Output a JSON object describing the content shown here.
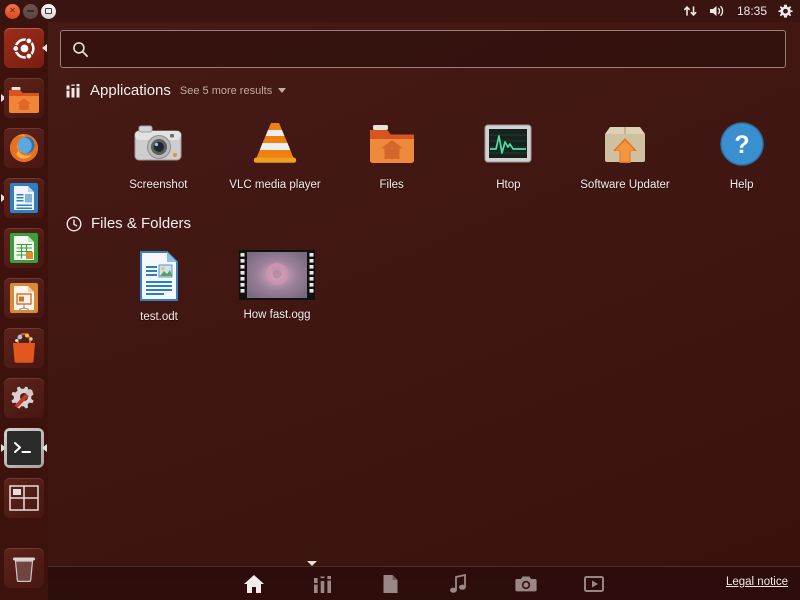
{
  "panel": {
    "window_controls": [
      {
        "name": "close",
        "glyph": "×",
        "color": "#d9481c"
      },
      {
        "name": "minimize",
        "glyph": "–",
        "color": "#5a4340"
      },
      {
        "name": "maximize",
        "glyph": "▭",
        "color": "#d8d2d0"
      }
    ],
    "indicators": [
      {
        "name": "network-icon",
        "label": "network"
      },
      {
        "name": "volume-icon",
        "label": "volume"
      }
    ],
    "clock": "18:35",
    "session_icon": "gear-icon"
  },
  "launcher": {
    "items": [
      {
        "name": "ubuntu-dash-button",
        "label": "Ubuntu Dash home",
        "icon": "ubuntu-logo",
        "active": true,
        "running": false
      },
      {
        "name": "launcher-item-files",
        "label": "Files",
        "icon": "folder-home",
        "running": true
      },
      {
        "name": "launcher-item-firefox",
        "label": "Firefox Web Browser",
        "icon": "firefox",
        "running": false
      },
      {
        "name": "launcher-item-writer",
        "label": "LibreOffice Writer",
        "icon": "writer",
        "running": true
      },
      {
        "name": "launcher-item-calc",
        "label": "LibreOffice Calc",
        "icon": "calc",
        "running": false
      },
      {
        "name": "launcher-item-impress",
        "label": "LibreOffice Impress",
        "icon": "impress",
        "running": false
      },
      {
        "name": "launcher-item-software-center",
        "label": "Ubuntu Software Center",
        "icon": "software-bag",
        "running": false
      },
      {
        "name": "launcher-item-system-settings",
        "label": "System Settings",
        "icon": "gear-wrench",
        "running": false
      },
      {
        "name": "launcher-item-terminal",
        "label": "Terminal",
        "icon": "terminal",
        "running": true
      },
      {
        "name": "launcher-item-workspace-switcher",
        "label": "Workspace Switcher",
        "icon": "workspaces",
        "running": false
      }
    ],
    "trash": {
      "name": "launcher-item-trash",
      "label": "Trash",
      "icon": "trash"
    }
  },
  "dash": {
    "search": {
      "value": "",
      "placeholder": "",
      "icon": "search-icon"
    },
    "groups": [
      {
        "id": "applications",
        "title": "Applications",
        "icon": "applications-icon",
        "more_label": "See 5 more results",
        "results": [
          {
            "label": "Screenshot",
            "icon": "camera"
          },
          {
            "label": "VLC media player",
            "icon": "vlc-cone"
          },
          {
            "label": "Files",
            "icon": "folder-home"
          },
          {
            "label": "Htop",
            "icon": "htop-monitor"
          },
          {
            "label": "Software Updater",
            "icon": "update-box"
          },
          {
            "label": "Help",
            "icon": "help-question"
          }
        ]
      },
      {
        "id": "files_and_folders",
        "title": "Files & Folders",
        "icon": "clock-icon",
        "more_label": "",
        "results": [
          {
            "label": "test.odt",
            "icon": "odt-document"
          },
          {
            "label": "How fast.ogg",
            "icon": "video-thumbnail"
          }
        ]
      }
    ],
    "bottom_bar": {
      "lenses": [
        {
          "name": "lens-home",
          "label": "Home",
          "icon": "home-icon",
          "active": true
        },
        {
          "name": "lens-applications",
          "label": "Applications",
          "icon": "applications-icon",
          "active": false
        },
        {
          "name": "lens-files",
          "label": "Files",
          "icon": "file-icon",
          "active": false
        },
        {
          "name": "lens-music",
          "label": "Music",
          "icon": "music-note-icon",
          "active": false
        },
        {
          "name": "lens-photos",
          "label": "Photos",
          "icon": "camera-icon",
          "active": false
        },
        {
          "name": "lens-video",
          "label": "Video",
          "icon": "play-icon",
          "active": false
        }
      ],
      "legal_notice": "Legal notice"
    }
  },
  "colors": {
    "desktop": "#4a1a15",
    "launcher": "#3d120c",
    "panel": "#3a1410",
    "accent_orange": "#dd4814",
    "text": "#f2eceа"
  }
}
